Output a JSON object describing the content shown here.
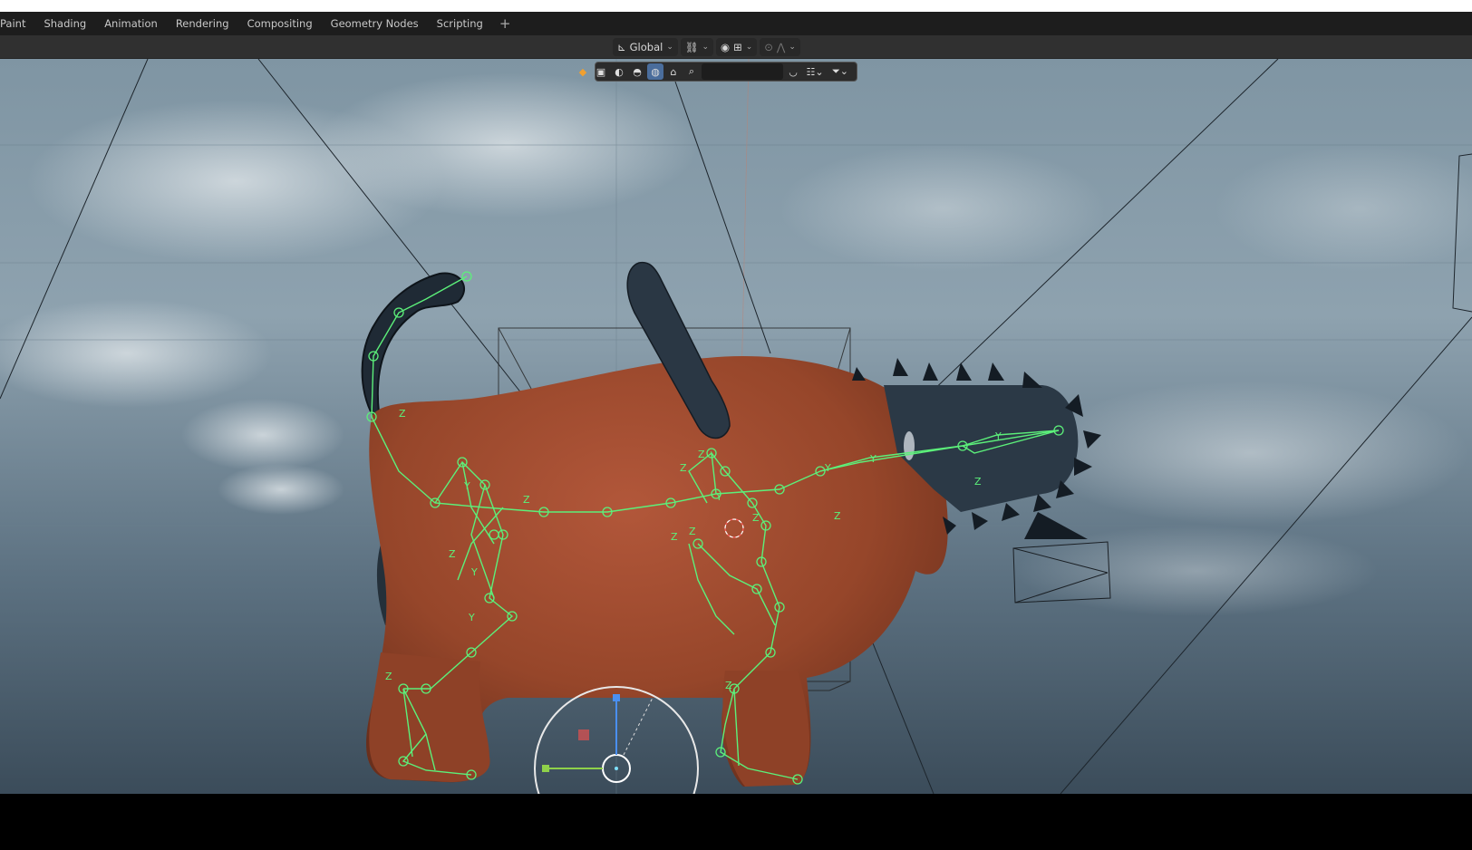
{
  "workspace_tabs": [
    "Paint",
    "Shading",
    "Animation",
    "Rendering",
    "Compositing",
    "Geometry Nodes",
    "Scripting"
  ],
  "add_workspace": "+",
  "header": {
    "orientation": "Global",
    "orientation_icon": "transform-orientation-icon",
    "pivot_icon": "pivot-link-icon",
    "snap_icon": "snap-magnet-icon",
    "snap_target_icon": "snap-increment-icon",
    "proportional_icon": "proportional-edit-icon",
    "falloff_icon": "falloff-curve-icon"
  },
  "overlay_bar": {
    "search_placeholder": "",
    "icons": [
      "scene-cube-icon",
      "solid-shading-icon",
      "material-shading-icon",
      "rendered-shading-icon",
      "world-icon",
      "render-region-icon",
      "search-icon",
      "collapse-icon",
      "display-mode-icon",
      "filter-icon"
    ]
  },
  "viewport": {
    "sky_color_top": "#8fa4b2",
    "sky_color_bottom": "#3d4f5e",
    "body_color": "#9a4a2b",
    "rig_color": "#5cf07a",
    "chain_color": "#1f2a35",
    "axis_labels": [
      "Y",
      "Z",
      "Y",
      "Z",
      "Z",
      "Y",
      "Z",
      "Y",
      "Z",
      "Z",
      "Z",
      "Y",
      "Y",
      "Z",
      "Z",
      "Y",
      "Z",
      "Z",
      "Z"
    ]
  }
}
